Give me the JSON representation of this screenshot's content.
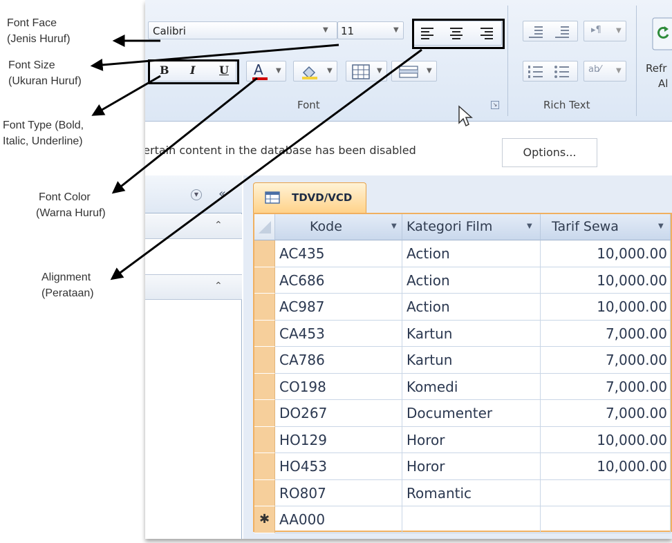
{
  "annotations": [
    {
      "id": "font_face",
      "lines": [
        "Font Face",
        "(Jenis Huruf)"
      ]
    },
    {
      "id": "font_size",
      "lines": [
        "Font Size",
        "(Ukuran Huruf)"
      ]
    },
    {
      "id": "font_type",
      "lines": [
        "Font Type (Bold,",
        "Italic, Underline)"
      ]
    },
    {
      "id": "font_color",
      "lines": [
        "Font Color",
        "(Warna Huruf)"
      ]
    },
    {
      "id": "alignment",
      "lines": [
        "Alignment",
        "(Perataan)"
      ]
    }
  ],
  "ribbon": {
    "font_face_value": "Calibri",
    "font_size_value": "11",
    "bold_label": "B",
    "italic_label": "I",
    "underline_label": "U",
    "font_color_label": "A",
    "font_group_label": "Font",
    "rich_text_group_label": "Rich Text",
    "refresh_label_line1": "Refr",
    "refresh_label_line2": "Al",
    "font_color_hex": "#d00000"
  },
  "message_bar": {
    "text": "Certain content in the database has been disabled",
    "options_button": "Options..."
  },
  "nav_pane": {
    "collapse_glyph": "«"
  },
  "table": {
    "tab_label": "TDVD/VCD",
    "columns": [
      "Kode",
      "Kategori Film",
      "Tarif Sewa"
    ],
    "rows": [
      [
        "AC435",
        "Action",
        "10,000.00"
      ],
      [
        "AC686",
        "Action",
        "10,000.00"
      ],
      [
        "AC987",
        "Action",
        "10,000.00"
      ],
      [
        "CA453",
        "Kartun",
        "7,000.00"
      ],
      [
        "CA786",
        "Kartun",
        "7,000.00"
      ],
      [
        "CO198",
        "Komedi",
        "7,000.00"
      ],
      [
        "DO267",
        "Documenter",
        "7,000.00"
      ],
      [
        "HO129",
        "Horor",
        "10,000.00"
      ],
      [
        "HO453",
        "Horor",
        "10,000.00"
      ],
      [
        "RO807",
        "Romantic",
        ""
      ]
    ],
    "new_row": {
      "marker": "✱",
      "kode": "AA000"
    }
  }
}
